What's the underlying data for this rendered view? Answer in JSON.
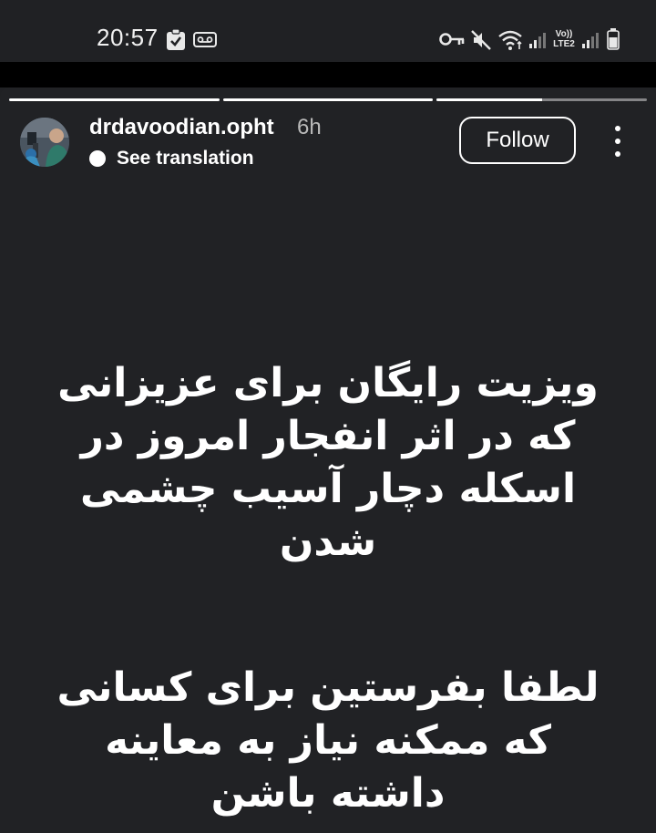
{
  "status_bar": {
    "time": "20:57",
    "network_label_top": "Vo))",
    "network_label_bottom": "LTE2",
    "icons": [
      "clipboard-check-icon",
      "voicemail-icon",
      "vpn-key-icon",
      "mute-icon",
      "wifi-icon",
      "signal-icon",
      "signal-icon"
    ]
  },
  "story": {
    "progress": [
      1.0,
      1.0,
      0.5
    ],
    "username": "drdavoodian.opht",
    "time_ago": "6h",
    "see_translation": "See translation",
    "follow_label": "Follow",
    "paragraph1": [
      "ویزیت رایگان برای عزیزانی",
      "که در اثر انفجار امروز در",
      "اسکله دچار آسیب چشمی",
      "شدن"
    ],
    "paragraph2": [
      "لطفا بفرستین برای کسانی",
      "که ممکنه نیاز به معاینه",
      "داشته باشن"
    ]
  },
  "colors": {
    "background": "#212225",
    "status_bar": "#202124",
    "text": "#ffffff",
    "muted": "#b9b9b9"
  }
}
